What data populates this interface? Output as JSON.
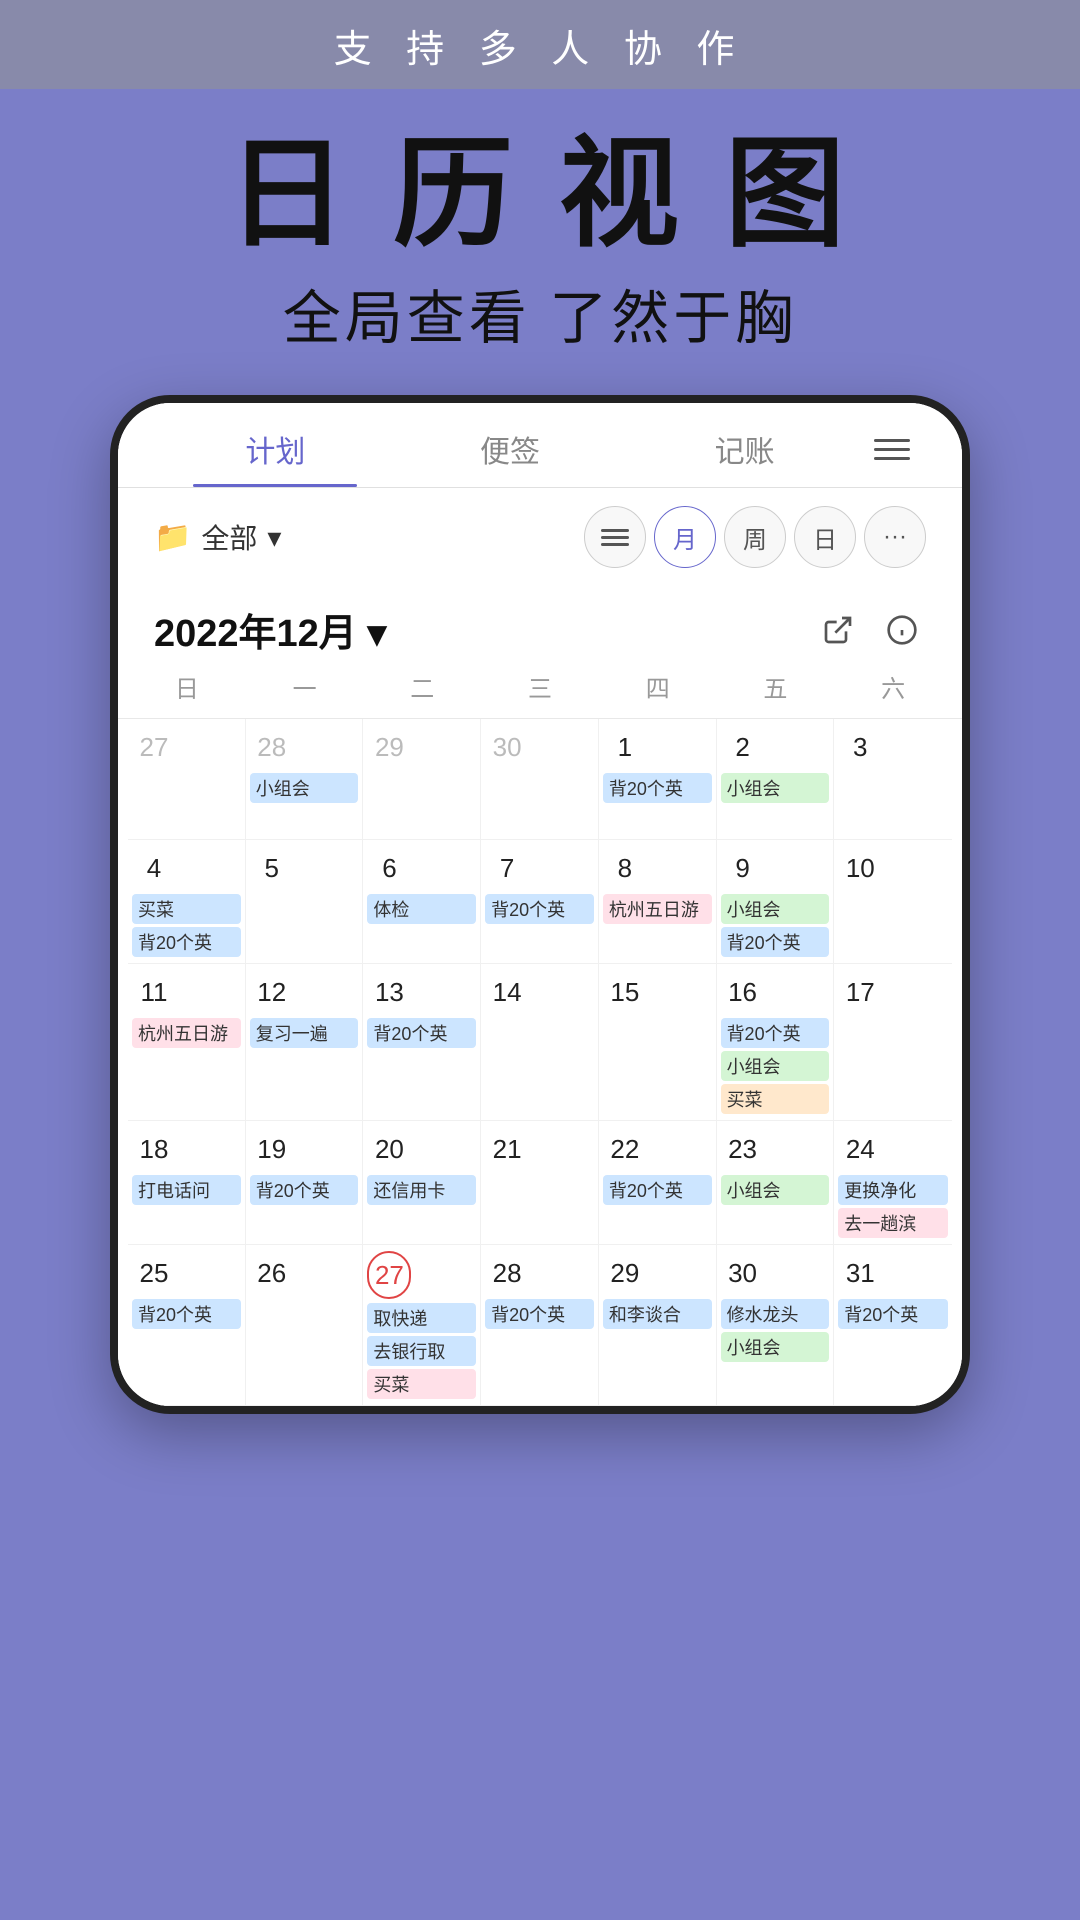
{
  "banner": {
    "text": "支 持 多 人 协 作"
  },
  "hero": {
    "title": "日 历 视 图",
    "subtitle": "全局查看  了然于胸"
  },
  "tabs": [
    {
      "label": "计划",
      "active": true
    },
    {
      "label": "便签",
      "active": false
    },
    {
      "label": "记账",
      "active": false
    }
  ],
  "toolbar": {
    "folder_label": "全部",
    "views": [
      "≡",
      "月",
      "周",
      "日",
      "···"
    ]
  },
  "calendar": {
    "month_label": "2022年12月 ▾",
    "day_headers": [
      "日",
      "一",
      "二",
      "三",
      "四",
      "五",
      "六"
    ],
    "weeks": [
      {
        "days": [
          {
            "num": "27",
            "other": true,
            "events": []
          },
          {
            "num": "28",
            "other": true,
            "events": [
              {
                "text": "小组会",
                "color": "ev-blue"
              }
            ]
          },
          {
            "num": "29",
            "other": true,
            "events": []
          },
          {
            "num": "30",
            "other": true,
            "events": []
          },
          {
            "num": "1",
            "events": [
              {
                "text": "背20个英",
                "color": "ev-blue"
              }
            ]
          },
          {
            "num": "2",
            "events": [
              {
                "text": "小组会",
                "color": "ev-green"
              }
            ]
          },
          {
            "num": "3",
            "events": []
          }
        ]
      },
      {
        "days": [
          {
            "num": "4",
            "events": [
              {
                "text": "买菜",
                "color": "ev-blue"
              },
              {
                "text": "背20个英",
                "color": "ev-blue"
              }
            ]
          },
          {
            "num": "5",
            "events": []
          },
          {
            "num": "6",
            "events": [
              {
                "text": "体检",
                "color": "ev-blue"
              }
            ]
          },
          {
            "num": "7",
            "events": [
              {
                "text": "背20个英",
                "color": "ev-blue"
              }
            ]
          },
          {
            "num": "8",
            "events": [
              {
                "text": "杭州五日游",
                "color": "ev-pink",
                "span": true
              }
            ]
          },
          {
            "num": "9",
            "events": [
              {
                "text": "小组会",
                "color": "ev-green"
              },
              {
                "text": "背20个英",
                "color": "ev-blue"
              }
            ]
          },
          {
            "num": "10",
            "events": []
          }
        ]
      },
      {
        "days": [
          {
            "num": "11",
            "events": [
              {
                "text": "杭州五日游",
                "color": "ev-pink",
                "span": true
              }
            ]
          },
          {
            "num": "12",
            "events": [
              {
                "text": "复习一遍",
                "color": "ev-blue"
              }
            ]
          },
          {
            "num": "13",
            "events": [
              {
                "text": "背20个英",
                "color": "ev-blue"
              }
            ]
          },
          {
            "num": "14",
            "events": []
          },
          {
            "num": "15",
            "events": []
          },
          {
            "num": "16",
            "events": [
              {
                "text": "背20个英",
                "color": "ev-blue"
              },
              {
                "text": "小组会",
                "color": "ev-green"
              },
              {
                "text": "买菜",
                "color": "ev-orange"
              }
            ]
          },
          {
            "num": "17",
            "events": []
          }
        ]
      },
      {
        "days": [
          {
            "num": "18",
            "events": [
              {
                "text": "打电话问",
                "color": "ev-blue"
              }
            ]
          },
          {
            "num": "19",
            "events": [
              {
                "text": "背20个英",
                "color": "ev-blue"
              }
            ]
          },
          {
            "num": "20",
            "events": [
              {
                "text": "还信用卡",
                "color": "ev-blue"
              }
            ]
          },
          {
            "num": "21",
            "events": []
          },
          {
            "num": "22",
            "events": [
              {
                "text": "背20个英",
                "color": "ev-blue"
              }
            ]
          },
          {
            "num": "23",
            "events": [
              {
                "text": "小组会",
                "color": "ev-green"
              }
            ]
          },
          {
            "num": "24",
            "events": [
              {
                "text": "更换净化",
                "color": "ev-blue"
              },
              {
                "text": "去一趟滨",
                "color": "ev-pink"
              }
            ]
          }
        ]
      },
      {
        "days": [
          {
            "num": "25",
            "events": [
              {
                "text": "背20个英",
                "color": "ev-blue"
              }
            ]
          },
          {
            "num": "26",
            "events": []
          },
          {
            "num": "27",
            "today": true,
            "events": [
              {
                "text": "取快递",
                "color": "ev-blue"
              },
              {
                "text": "去银行取",
                "color": "ev-blue"
              },
              {
                "text": "买菜",
                "color": "ev-pink"
              }
            ]
          },
          {
            "num": "28",
            "events": [
              {
                "text": "背20个英",
                "color": "ev-blue"
              }
            ]
          },
          {
            "num": "29",
            "events": [
              {
                "text": "和李谈合",
                "color": "ev-blue"
              }
            ]
          },
          {
            "num": "30",
            "events": [
              {
                "text": "修水龙头",
                "color": "ev-blue"
              },
              {
                "text": "小组会",
                "color": "ev-green"
              }
            ]
          },
          {
            "num": "31",
            "events": [
              {
                "text": "背20个英",
                "color": "ev-blue"
              }
            ]
          }
        ]
      }
    ]
  }
}
